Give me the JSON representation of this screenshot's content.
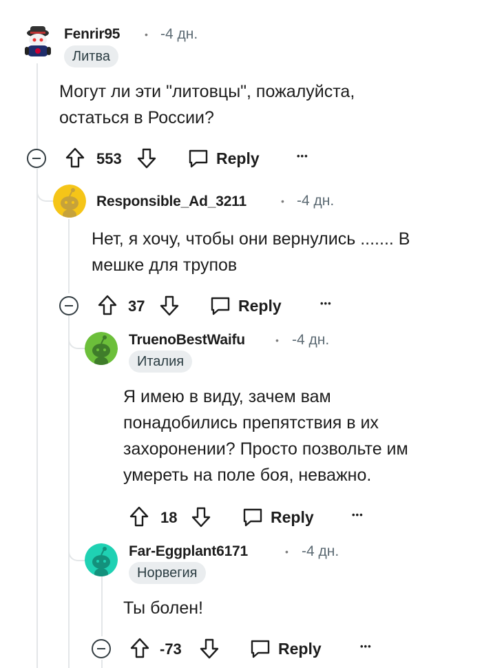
{
  "comments": [
    {
      "username": "Fenrir95",
      "time": "-4 дн.",
      "flair": "Литва",
      "body_lines": [
        "Могут ли эти \"литовцы\", пожалуйста,",
        "остаться в России?"
      ],
      "score": "553",
      "reply_label": "Reply",
      "more": "•••"
    },
    {
      "username": "Responsible_Ad_3211",
      "time": "-4 дн.",
      "flair": "",
      "body_lines": [
        "Нет, я хочу, чтобы они вернулись ....... В",
        "мешке для трупов"
      ],
      "score": "37",
      "reply_label": "Reply",
      "more": "•••"
    },
    {
      "username": "TruenoBestWaifu",
      "time": "-4 дн.",
      "flair": "Италия",
      "body_lines": [
        "Я имею в виду, зачем вам",
        "понадобились препятствия в их",
        "захоронении? Просто позвольте им",
        "умереть на поле боя, неважно."
      ],
      "score": "18",
      "reply_label": "Reply",
      "more": "•••"
    },
    {
      "username": "Far-Eggplant6171",
      "time": "-4 дн.",
      "flair": "Норвегия",
      "body_lines": [
        "Ты болен!"
      ],
      "score": "-73",
      "reply_label": "Reply",
      "more": "•••"
    }
  ],
  "separator": "•",
  "colors": {
    "text": "#1c1c1c",
    "meta": "#5c6a73",
    "flair_bg": "#eaedef",
    "thread_line": "#e3e6e8",
    "avatar_yellow": "#f1c40f",
    "avatar_green": "#6cbf3a",
    "avatar_teal": "#1fd1b3"
  },
  "icons": [
    "upvote-icon",
    "downvote-icon",
    "reply-bubble-icon",
    "collapse-icon",
    "more-options-icon"
  ]
}
